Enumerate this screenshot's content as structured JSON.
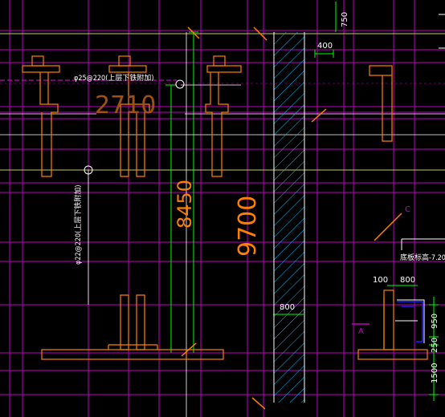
{
  "colors": {
    "background": "#000000",
    "magenta": "#c000c0",
    "white": "#ffffff",
    "orange": "#ff8000",
    "green": "#00ff00",
    "cyan": "#00c0ff",
    "yellow": "#ffff00",
    "blue": "#0000ff",
    "olive": "#808000",
    "dimension_text": "#c0c0c0"
  },
  "annotations": {
    "rebar_top": "φ25@220(上层下铁附加)",
    "rebar_mid": "φ22@220(上层下铁附加)",
    "bottom_elevation": "底板标高-7.20",
    "section_a": "A",
    "section_c": "C"
  },
  "dimensions": {
    "d_2710": "2710",
    "d_8450": "8450",
    "d_9700": "9700",
    "d_400": "400",
    "d_750": "750",
    "d_800_wall": "800",
    "d_100": "100",
    "d_800_right": "800",
    "d_950": "950",
    "d_250": "250",
    "d_1500": "1500"
  }
}
